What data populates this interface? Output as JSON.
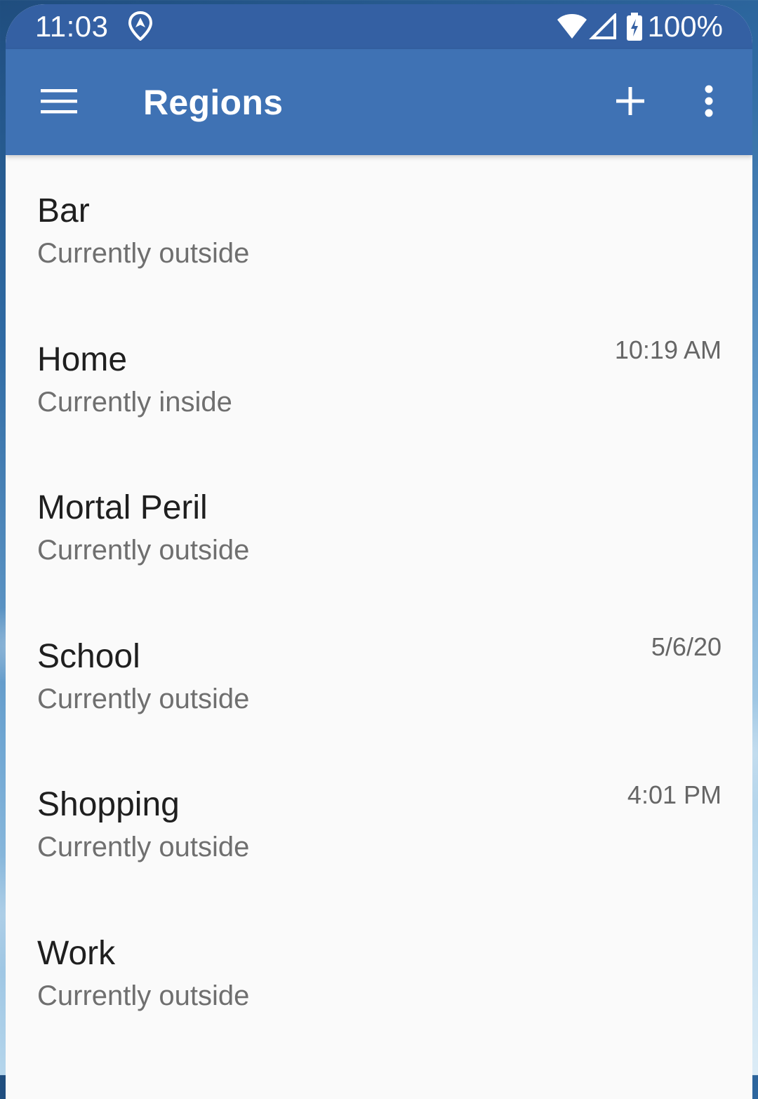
{
  "status_bar": {
    "time": "11:03",
    "battery_percent": "100%",
    "icons": [
      "location-icon",
      "wifi-icon",
      "cellular-signal-icon",
      "battery-charging-icon"
    ],
    "color": "#3460a3"
  },
  "app_bar": {
    "title": "Regions",
    "color": "#3f72b4",
    "icons": [
      "menu-icon",
      "add-icon",
      "more-vert-icon"
    ]
  },
  "regions": [
    {
      "name": "Bar",
      "status": "Currently outside",
      "time": ""
    },
    {
      "name": "Home",
      "status": "Currently inside",
      "time": "10:19 AM"
    },
    {
      "name": "Mortal Peril",
      "status": "Currently outside",
      "time": ""
    },
    {
      "name": "School",
      "status": "Currently outside",
      "time": "5/6/20"
    },
    {
      "name": "Shopping",
      "status": "Currently outside",
      "time": "4:01 PM"
    },
    {
      "name": "Work",
      "status": "Currently outside",
      "time": ""
    }
  ]
}
